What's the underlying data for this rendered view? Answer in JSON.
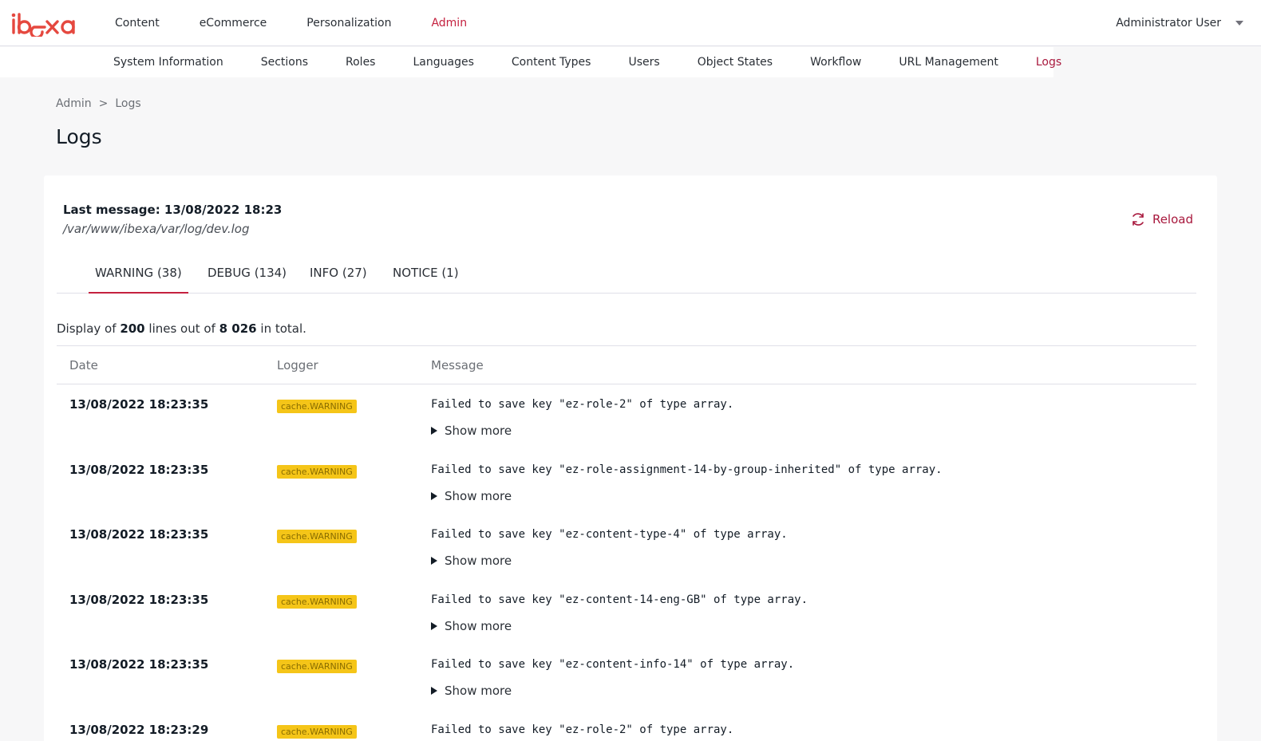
{
  "app": {
    "brand": "ibexa",
    "accent": "#c4213f"
  },
  "topnav": {
    "items": [
      {
        "label": "Content"
      },
      {
        "label": "eCommerce"
      },
      {
        "label": "Personalization"
      },
      {
        "label": "Admin"
      }
    ],
    "active_index": 3,
    "user": "Administrator User"
  },
  "subnav": {
    "items": [
      {
        "label": "System Information"
      },
      {
        "label": "Sections"
      },
      {
        "label": "Roles"
      },
      {
        "label": "Languages"
      },
      {
        "label": "Content Types"
      },
      {
        "label": "Users"
      },
      {
        "label": "Object States"
      },
      {
        "label": "Workflow"
      },
      {
        "label": "URL Management"
      },
      {
        "label": "Logs"
      }
    ],
    "active_index": 9
  },
  "breadcrumb": {
    "root": "Admin",
    "sep": ">",
    "current": "Logs"
  },
  "page": {
    "title": "Logs"
  },
  "log": {
    "last_message": "Last message: 13/08/2022 18:23",
    "path": "/var/www/ibexa/var/log/dev.log",
    "reload_label": "Reload"
  },
  "tabs": [
    {
      "label": "WARNING (38)"
    },
    {
      "label": "DEBUG (134)"
    },
    {
      "label": "INFO (27)"
    },
    {
      "label": "NOTICE (1)"
    }
  ],
  "active_tab": 0,
  "summary": {
    "prefix": "Display of",
    "shown": "200",
    "middle": "lines out of",
    "total": "8 026",
    "suffix": "in total."
  },
  "table": {
    "headers": {
      "date": "Date",
      "logger": "Logger",
      "message": "Message"
    },
    "show_more_label": "Show more",
    "rows": [
      {
        "date": "13/08/2022 18:23:35",
        "logger": "cache.WARNING",
        "message": "Failed to save key \"ez-role-2\" of type array."
      },
      {
        "date": "13/08/2022 18:23:35",
        "logger": "cache.WARNING",
        "message": "Failed to save key \"ez-role-assignment-14-by-group-inherited\" of type array."
      },
      {
        "date": "13/08/2022 18:23:35",
        "logger": "cache.WARNING",
        "message": "Failed to save key \"ez-content-type-4\" of type array."
      },
      {
        "date": "13/08/2022 18:23:35",
        "logger": "cache.WARNING",
        "message": "Failed to save key \"ez-content-14-eng-GB\" of type array."
      },
      {
        "date": "13/08/2022 18:23:35",
        "logger": "cache.WARNING",
        "message": "Failed to save key \"ez-content-info-14\" of type array."
      },
      {
        "date": "13/08/2022 18:23:29",
        "logger": "cache.WARNING",
        "message": "Failed to save key \"ez-role-2\" of type array."
      }
    ]
  }
}
